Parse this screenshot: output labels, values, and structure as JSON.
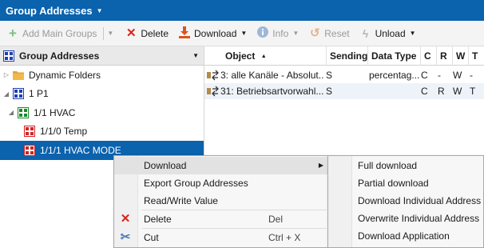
{
  "titlebar": {
    "title": "Group Addresses",
    "caret_icon": "chevron-down-icon"
  },
  "toolbar": {
    "add_main_groups": "Add Main Groups",
    "delete": "Delete",
    "download": "Download",
    "info": "Info",
    "reset": "Reset",
    "unload": "Unload"
  },
  "left_panel": {
    "header": "Group Addresses",
    "tree": [
      {
        "label": "Dynamic Folders",
        "icon": "folder-icon"
      },
      {
        "label": "1 P1",
        "icon": "main-group-icon"
      },
      {
        "label": "1/1 HVAC",
        "icon": "middle-group-icon"
      },
      {
        "label": "1/1/0 Temp",
        "icon": "group-address-icon"
      },
      {
        "label": "1/1/1 HVAC MODE",
        "icon": "group-address-icon",
        "selected": true
      }
    ]
  },
  "grid": {
    "columns": [
      "Object",
      "Sending",
      "Data Type",
      "C",
      "R",
      "W",
      "T"
    ],
    "sort_indicator": "▲",
    "rows": [
      {
        "object": "3: alle Kanäle - Absolut...",
        "sending": "S",
        "data_type": "percentag...",
        "c": "C",
        "r": "-",
        "w": "W",
        "t": "-"
      },
      {
        "object": "31: Betriebsartvorwahl...",
        "sending": "S",
        "data_type": "",
        "c": "C",
        "r": "R",
        "w": "W",
        "t": "T"
      }
    ]
  },
  "context_menu": {
    "download": "Download",
    "export": "Export Group Addresses",
    "readwrite": "Read/Write Value",
    "delete": "Delete",
    "delete_shortcut": "Del",
    "cut": "Cut",
    "cut_shortcut": "Ctrl + X"
  },
  "download_submenu": {
    "items": [
      "Full download",
      "Partial download",
      "Download Individual Address",
      "Overwrite Individual Address",
      "Download Application"
    ]
  },
  "colors": {
    "accent": "#0b62ad",
    "delete_red": "#d9241b",
    "download_orange": "#d9541e",
    "group_red": "#d42424",
    "group_green": "#1a8a2a",
    "group_blue": "#1f3fb4"
  }
}
